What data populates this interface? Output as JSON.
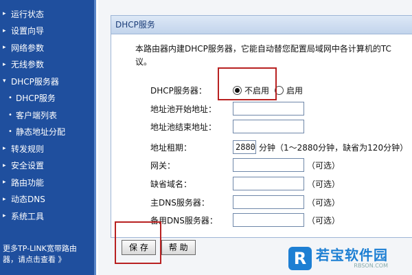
{
  "sidebar": {
    "items": [
      {
        "label": "运行状态",
        "sub": false
      },
      {
        "label": "设置向导",
        "sub": false
      },
      {
        "label": "网络参数",
        "sub": false
      },
      {
        "label": "无线参数",
        "sub": false
      },
      {
        "label": "DHCP服务器",
        "sub": false,
        "open": true
      },
      {
        "label": "DHCP服务",
        "sub": true
      },
      {
        "label": "客户端列表",
        "sub": true
      },
      {
        "label": "静态地址分配",
        "sub": true
      },
      {
        "label": "转发规则",
        "sub": false
      },
      {
        "label": "安全设置",
        "sub": false
      },
      {
        "label": "路由功能",
        "sub": false
      },
      {
        "label": "动态DNS",
        "sub": false
      },
      {
        "label": "系统工具",
        "sub": false
      }
    ],
    "footer_line1": "更多TP-LINK宽带路由",
    "footer_line2": "器，请点击查看 》"
  },
  "panel": {
    "title": "DHCP服务",
    "intro_line1": "本路由器内建DHCP服务器，它能自动替您配置局域网中各计算机的TC",
    "intro_line2": "议。",
    "dhcp_label": "DHCP服务器：",
    "radio_disable": "不启用",
    "radio_enable": "启用",
    "selected": "disable",
    "start_label": "地址池开始地址：",
    "start_value": "",
    "end_label": "地址池结束地址：",
    "end_value": "",
    "lease_label": "地址租期：",
    "lease_value": "2880",
    "lease_hint": "分钟（1～2880分钟，缺省为120分钟）",
    "gateway_label": "网关：",
    "gateway_value": "",
    "domain_label": "缺省域名：",
    "domain_value": "",
    "dns1_label": "主DNS服务器：",
    "dns1_value": "",
    "dns2_label": "备用DNS服务器：",
    "dns2_value": "",
    "optional": "（可选）"
  },
  "buttons": {
    "save": "保 存",
    "help": "帮 助"
  },
  "watermark": {
    "logo_letter": "R",
    "name": "若宝软件园",
    "url": "RBSON.COM"
  },
  "colors": {
    "sidebar_bg": "#1f4f9e",
    "highlight": "#b82020",
    "watermark": "#1d7fd3"
  }
}
